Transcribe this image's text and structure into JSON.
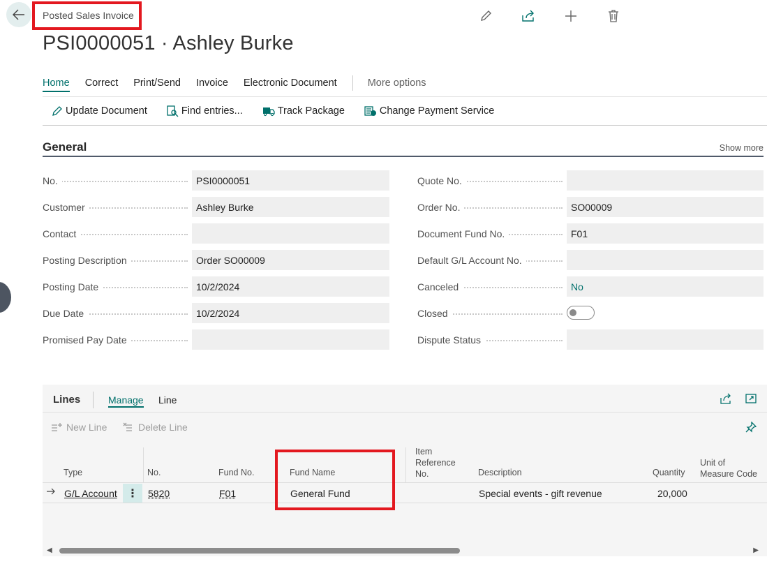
{
  "header": {
    "breadcrumb": "Posted Sales Invoice",
    "title": "PSI0000051 · Ashley Burke"
  },
  "tabs": [
    "Home",
    "Correct",
    "Print/Send",
    "Invoice",
    "Electronic Document"
  ],
  "tabs_more": "More options",
  "actions": {
    "update_document": "Update Document",
    "find_entries": "Find entries...",
    "track_package": "Track Package",
    "change_payment_service": "Change Payment Service"
  },
  "general": {
    "title": "General",
    "show_more": "Show more",
    "left": [
      {
        "label": "No.",
        "value": "PSI0000051"
      },
      {
        "label": "Customer",
        "value": "Ashley Burke"
      },
      {
        "label": "Contact",
        "value": ""
      },
      {
        "label": "Posting Description",
        "value": "Order SO00009"
      },
      {
        "label": "Posting Date",
        "value": "10/2/2024"
      },
      {
        "label": "Due Date",
        "value": "10/2/2024"
      },
      {
        "label": "Promised Pay Date",
        "value": ""
      }
    ],
    "right": [
      {
        "label": "Quote No.",
        "value": ""
      },
      {
        "label": "Order No.",
        "value": "SO00009"
      },
      {
        "label": "Document Fund No.",
        "value": "F01"
      },
      {
        "label": "Default G/L Account No.",
        "value": ""
      },
      {
        "label": "Canceled",
        "value": "No"
      },
      {
        "label": "Closed",
        "value": ""
      },
      {
        "label": "Dispute Status",
        "value": ""
      }
    ]
  },
  "lines": {
    "title": "Lines",
    "tabs": [
      "Manage",
      "Line"
    ],
    "new_line": "New Line",
    "delete_line": "Delete Line",
    "columns": {
      "type": "Type",
      "no": "No.",
      "fund_no": "Fund No.",
      "fund_name": "Fund Name",
      "item_ref_1": "Item",
      "item_ref_2": "Reference",
      "item_ref_3": "No.",
      "description": "Description",
      "quantity": "Quantity",
      "uom_1": "Unit of",
      "uom_2": "Measure Code"
    },
    "rows": [
      {
        "type": "G/L Account",
        "no": "5820",
        "fund_no": "F01",
        "fund_name": "General Fund",
        "description": "Special events - gift revenue",
        "quantity": "20,000"
      }
    ]
  },
  "colors": {
    "accent": "#00706b",
    "highlight": "#e3181f"
  }
}
